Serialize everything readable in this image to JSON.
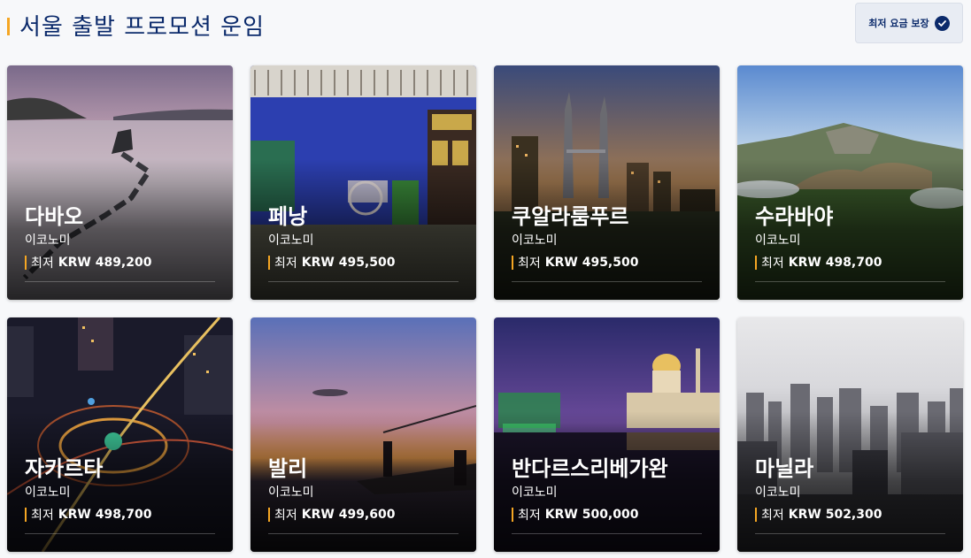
{
  "header": {
    "title": "서울  출발 프로모션 운임",
    "guarantee_label": "최저 요금 보장"
  },
  "colors": {
    "accent": "#f5a623",
    "navy": "#0b2a6b"
  },
  "price_prefix": "최저",
  "destinations": [
    {
      "city": "다바오",
      "cabin": "이코노미",
      "price": "KRW 489,200",
      "scene": "lake-dusk"
    },
    {
      "city": "페낭",
      "cabin": "이코노미",
      "price": "KRW 495,500",
      "scene": "blue-shophouse"
    },
    {
      "city": "쿠알라룸푸르",
      "cabin": "이코노미",
      "price": "KRW 495,500",
      "scene": "twin-towers"
    },
    {
      "city": "수라바야",
      "cabin": "이코노미",
      "price": "KRW 498,700",
      "scene": "volcano"
    },
    {
      "city": "자카르타",
      "cabin": "이코노미",
      "price": "KRW 498,700",
      "scene": "city-roundabout-night"
    },
    {
      "city": "발리",
      "cabin": "이코노미",
      "price": "KRW 499,600",
      "scene": "beach-sunset"
    },
    {
      "city": "반다르스리베가완",
      "cabin": "이코노미",
      "price": "KRW 500,000",
      "scene": "mosque-night"
    },
    {
      "city": "마닐라",
      "cabin": "이코노미",
      "price": "KRW 502,300",
      "scene": "skyline-day"
    }
  ]
}
